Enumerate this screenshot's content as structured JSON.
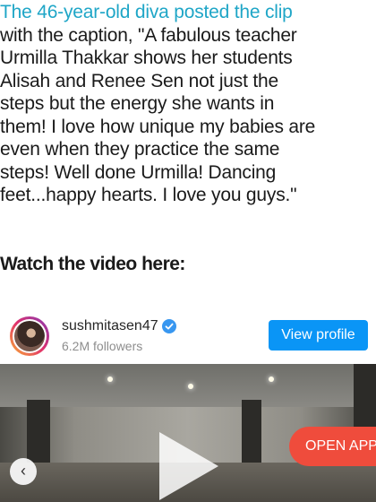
{
  "article": {
    "highlight": "The 46-year-old diva posted the clip",
    "lines": [
      "with the caption, \"A fabulous teacher",
      "Urmilla Thakkar shows her students",
      "Alisah and Renee Sen not just the",
      "steps but the energy she wants in",
      "them! I love how unique my babies are",
      "even when they practice the same",
      "steps! Well done Urmilla! Dancing",
      "feet...happy hearts. I love you guys.\""
    ],
    "heading": "Watch the video here:"
  },
  "embed": {
    "username": "sushmitasen47",
    "followers": "6.2M followers",
    "view_profile_label": "View profile",
    "open_app_label": "OPEN APP",
    "brand_color": "#0a95f6",
    "icons": [
      "verified-icon",
      "play-icon",
      "chevron-left-icon"
    ]
  }
}
